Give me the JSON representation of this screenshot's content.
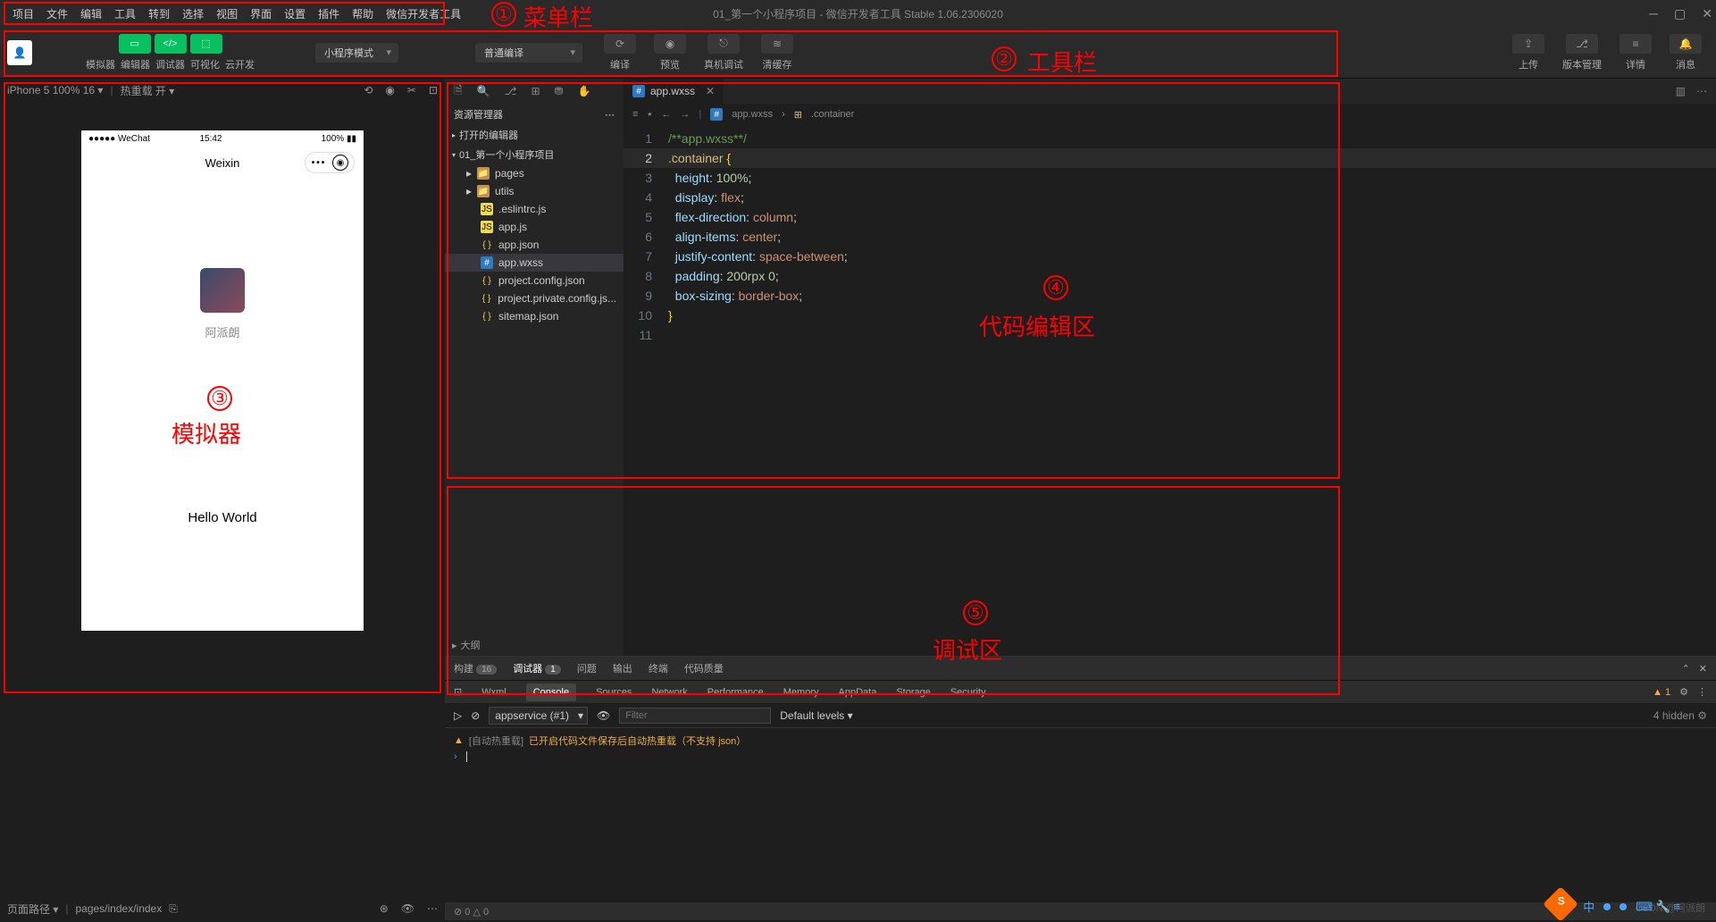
{
  "title": "01_第一个小程序项目 - 微信开发者工具 Stable 1.06.2306020",
  "menu": [
    "项目",
    "文件",
    "编辑",
    "工具",
    "转到",
    "选择",
    "视图",
    "界面",
    "设置",
    "插件",
    "帮助",
    "微信开发者工具"
  ],
  "toolbar": {
    "tabs": [
      "模拟器",
      "编辑器",
      "调试器",
      "可视化",
      "云开发"
    ],
    "mode": "小程序模式",
    "compile": "普通编译",
    "mid": [
      {
        "ic": "⟳",
        "lb": "编译"
      },
      {
        "ic": "◉",
        "lb": "预览"
      },
      {
        "ic": "⎋",
        "lb": "真机调试"
      },
      {
        "ic": "≋",
        "lb": "清缓存"
      }
    ],
    "right": [
      {
        "ic": "⇪",
        "lb": "上传"
      },
      {
        "ic": "⎇",
        "lb": "版本管理"
      },
      {
        "ic": "≡",
        "lb": "详情"
      },
      {
        "ic": "🔔",
        "lb": "消息"
      }
    ]
  },
  "simulator": {
    "device": "iPhone 5 100% 16 ▾",
    "hotreload": "热重载 开 ▾",
    "phone": {
      "carrier": "●●●●● WeChat",
      "time": "15:42",
      "battery": "100%",
      "title": "Weixin",
      "nick": "阿派朗",
      "hello": "Hello World"
    },
    "pathlabel": "页面路径 ▾",
    "path": "pages/index/index"
  },
  "explorer": {
    "title": "资源管理器",
    "openEditors": "打开的编辑器",
    "project": "01_第一个小程序项目",
    "files": [
      {
        "ic": "folder",
        "name": "pages",
        "chev": "▸",
        "sub": false
      },
      {
        "ic": "folder",
        "name": "utils",
        "chev": "▸",
        "sub": false
      },
      {
        "ic": "js",
        "name": ".eslintrc.js",
        "sub": true
      },
      {
        "ic": "js",
        "name": "app.js",
        "sub": true
      },
      {
        "ic": "json",
        "name": "app.json",
        "sub": true
      },
      {
        "ic": "wxss",
        "name": "app.wxss",
        "sub": true,
        "sel": true
      },
      {
        "ic": "json",
        "name": "project.config.json",
        "sub": true
      },
      {
        "ic": "json",
        "name": "project.private.config.js...",
        "sub": true
      },
      {
        "ic": "json",
        "name": "sitemap.json",
        "sub": true
      }
    ],
    "outline": "大纲"
  },
  "editor": {
    "tab": "app.wxss",
    "crumb1": "app.wxss",
    "crumb2": ".container",
    "lines": [
      {
        "n": 1,
        "t": [
          {
            "c": "c-comment",
            "v": "/**app.wxss**/"
          }
        ]
      },
      {
        "n": 2,
        "hl": true,
        "t": [
          {
            "c": "c-sel",
            "v": ".container"
          },
          {
            "c": "",
            "v": " "
          },
          {
            "c": "c-brace",
            "v": "{"
          }
        ]
      },
      {
        "n": 3,
        "t": [
          {
            "c": "",
            "v": "  "
          },
          {
            "c": "c-prop",
            "v": "height"
          },
          {
            "c": "c-punct",
            "v": ": "
          },
          {
            "c": "c-num",
            "v": "100%"
          },
          {
            "c": "c-punct",
            "v": ";"
          }
        ]
      },
      {
        "n": 4,
        "t": [
          {
            "c": "",
            "v": "  "
          },
          {
            "c": "c-prop",
            "v": "display"
          },
          {
            "c": "c-punct",
            "v": ": "
          },
          {
            "c": "c-val",
            "v": "flex"
          },
          {
            "c": "c-punct",
            "v": ";"
          }
        ]
      },
      {
        "n": 5,
        "t": [
          {
            "c": "",
            "v": "  "
          },
          {
            "c": "c-prop",
            "v": "flex-direction"
          },
          {
            "c": "c-punct",
            "v": ": "
          },
          {
            "c": "c-val",
            "v": "column"
          },
          {
            "c": "c-punct",
            "v": ";"
          }
        ]
      },
      {
        "n": 6,
        "t": [
          {
            "c": "",
            "v": "  "
          },
          {
            "c": "c-prop",
            "v": "align-items"
          },
          {
            "c": "c-punct",
            "v": ": "
          },
          {
            "c": "c-val",
            "v": "center"
          },
          {
            "c": "c-punct",
            "v": ";"
          }
        ]
      },
      {
        "n": 7,
        "t": [
          {
            "c": "",
            "v": "  "
          },
          {
            "c": "c-prop",
            "v": "justify-content"
          },
          {
            "c": "c-punct",
            "v": ": "
          },
          {
            "c": "c-val",
            "v": "space-between"
          },
          {
            "c": "c-punct",
            "v": ";"
          }
        ]
      },
      {
        "n": 8,
        "t": [
          {
            "c": "",
            "v": "  "
          },
          {
            "c": "c-prop",
            "v": "padding"
          },
          {
            "c": "c-punct",
            "v": ": "
          },
          {
            "c": "c-num",
            "v": "200rpx 0"
          },
          {
            "c": "c-punct",
            "v": ";"
          }
        ]
      },
      {
        "n": 9,
        "t": [
          {
            "c": "",
            "v": "  "
          },
          {
            "c": "c-prop",
            "v": "box-sizing"
          },
          {
            "c": "c-punct",
            "v": ": "
          },
          {
            "c": "c-val",
            "v": "border-box"
          },
          {
            "c": "c-punct",
            "v": ";"
          }
        ]
      },
      {
        "n": 10,
        "t": [
          {
            "c": "c-brace",
            "v": "}"
          }
        ]
      },
      {
        "n": 11,
        "t": []
      }
    ]
  },
  "debugger": {
    "tabs": [
      {
        "l": "构建",
        "b": "16"
      },
      {
        "l": "调试器",
        "b": "1",
        "act": true
      },
      {
        "l": "问题"
      },
      {
        "l": "输出"
      },
      {
        "l": "终端"
      },
      {
        "l": "代码质量"
      }
    ],
    "devtabs": [
      "Wxml",
      "Console",
      "Sources",
      "Network",
      "Performance",
      "Memory",
      "AppData",
      "Storage",
      "Security"
    ],
    "devact": "Console",
    "warn": "1",
    "ctx": "appservice (#1)",
    "filter": "Filter",
    "levels": "Default levels ▾",
    "hidden": "4 hidden",
    "logs": [
      {
        "t": "w",
        "pre": "[自动热重载]",
        "msg": "已开启代码文件保存后自动热重载（不支持 json）"
      }
    ],
    "status": "⊘ 0 △ 0"
  },
  "annotations": {
    "a1": "菜单栏",
    "a2": "工具栏",
    "a3": "模拟器",
    "a4": "代码编辑区",
    "a5": "调试区"
  },
  "watermark": "CSDN @阿派朗"
}
